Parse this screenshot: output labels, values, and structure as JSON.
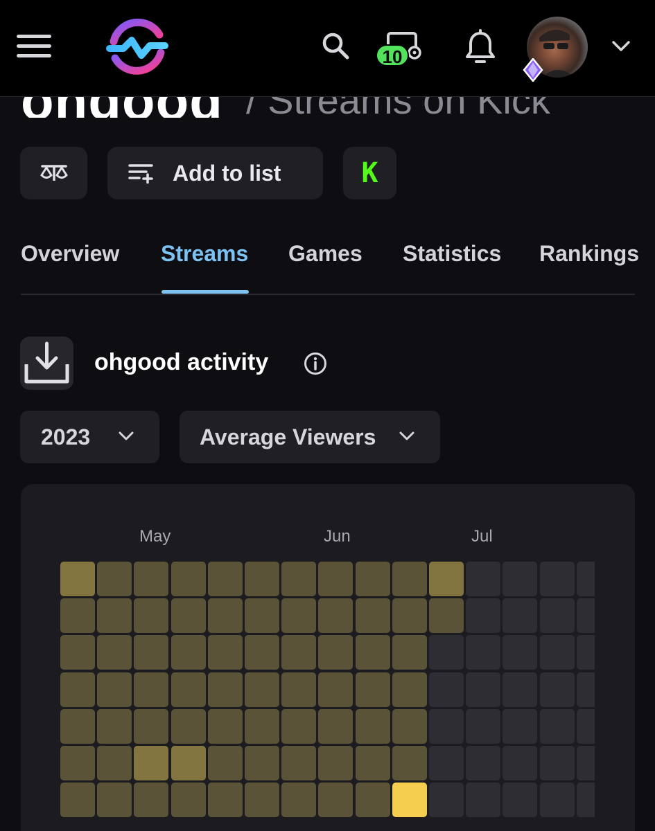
{
  "header": {
    "menu_icon": "hamburger-menu-icon",
    "logo": "streams-charts-logo",
    "search_icon": "search-icon",
    "stream_badge_count": "10",
    "notifications_icon": "bell-icon",
    "account_chevron": "chevron-down-icon",
    "accent_badge_color": "#53e25c"
  },
  "page": {
    "title": "ohgood",
    "subtitle": "/ Streams on Kick"
  },
  "actions": {
    "compare_icon": "scales-icon",
    "add_to_list_label": "Add to list",
    "add_to_list_icon": "playlist-add-icon",
    "platform_icon": "kick-logo-icon",
    "platform_color": "#53fc18"
  },
  "tabs": [
    {
      "label": "Overview",
      "active": false
    },
    {
      "label": "Streams",
      "active": true
    },
    {
      "label": "Games",
      "active": false
    },
    {
      "label": "Statistics",
      "active": false
    },
    {
      "label": "Rankings",
      "active": false
    }
  ],
  "activity": {
    "download_icon": "download-icon",
    "title": "ohgood activity",
    "info_icon": "info-icon",
    "year_select": "2023",
    "metric_select": "Average Viewers",
    "months": [
      "May",
      "Jun",
      "Jul"
    ],
    "colors": {
      "empty": "#2d2d33",
      "low": "#5a5337",
      "medium": "#837540",
      "high": "#f5cd4f"
    },
    "heatmap_levels": [
      [
        2,
        1,
        1,
        1,
        1,
        1,
        1,
        1,
        1,
        1,
        2,
        0,
        0,
        0,
        0
      ],
      [
        1,
        1,
        1,
        1,
        1,
        1,
        1,
        1,
        1,
        1,
        1,
        0,
        0,
        0,
        0
      ],
      [
        1,
        1,
        1,
        1,
        1,
        1,
        1,
        1,
        1,
        1,
        0,
        0,
        0,
        0,
        0
      ],
      [
        1,
        1,
        1,
        1,
        1,
        1,
        1,
        1,
        1,
        1,
        0,
        0,
        0,
        0,
        0
      ],
      [
        1,
        1,
        1,
        1,
        1,
        1,
        1,
        1,
        1,
        1,
        0,
        0,
        0,
        0,
        0
      ],
      [
        1,
        1,
        2,
        2,
        1,
        1,
        1,
        1,
        1,
        1,
        0,
        0,
        0,
        0,
        0
      ],
      [
        1,
        1,
        1,
        1,
        1,
        1,
        1,
        1,
        1,
        3,
        0,
        0,
        0,
        0,
        0
      ]
    ]
  }
}
